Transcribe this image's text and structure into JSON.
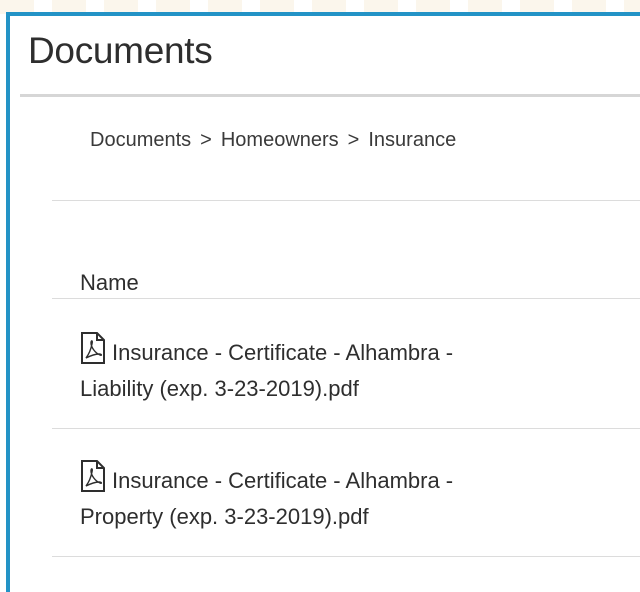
{
  "page": {
    "title": "Documents"
  },
  "breadcrumb": {
    "items": [
      "Documents",
      "Homeowners",
      "Insurance"
    ],
    "separator": ">"
  },
  "table": {
    "column_header": "Name",
    "files": [
      {
        "icon": "pdf-file-icon",
        "line1": "Insurance - Certificate - Alhambra -",
        "line2": "Liability (exp. 3-23-2019).pdf"
      },
      {
        "icon": "pdf-file-icon",
        "line1": "Insurance - Certificate - Alhambra -",
        "line2": "Property (exp. 3-23-2019).pdf"
      }
    ]
  },
  "colors": {
    "accent_border": "#2393c6",
    "rule": "#dcdcdc",
    "text": "#2e2e2e"
  }
}
